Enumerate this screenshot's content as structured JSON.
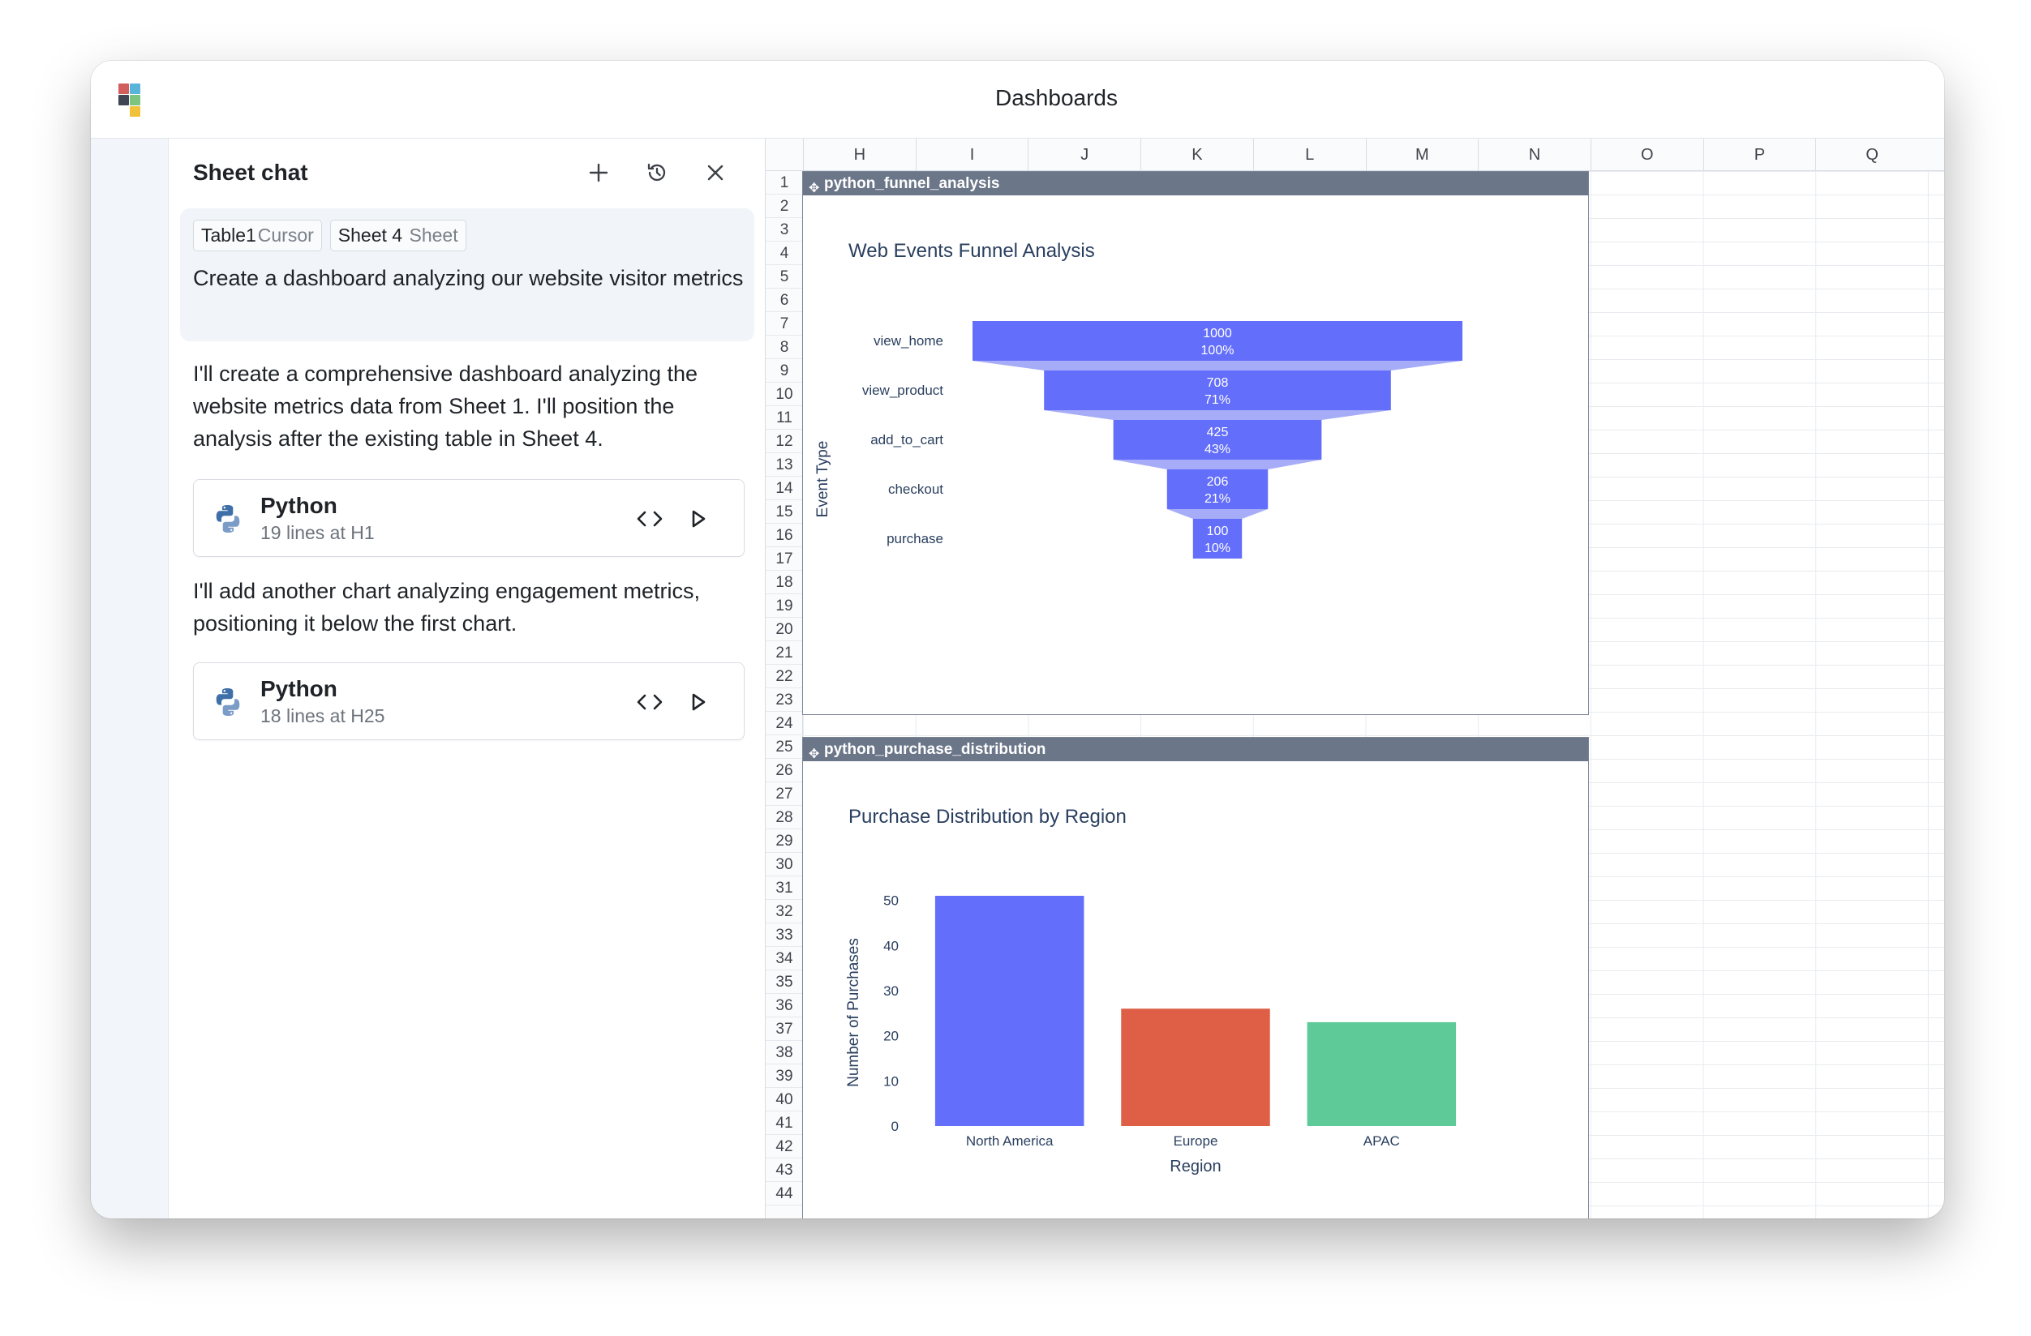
{
  "header": {
    "title": "Dashboards"
  },
  "chat": {
    "title": "Sheet chat",
    "chips": [
      {
        "name": "Table1",
        "type": "Cursor"
      },
      {
        "name": "Sheet 4",
        "type": "Sheet"
      }
    ],
    "user_message": "Create a dashboard analyzing our website visitor metrics",
    "assistant_messages": [
      "I'll create a comprehensive dashboard analyzing the website metrics data from Sheet 1. I'll position the analysis after the existing table in Sheet 4.",
      "I'll add another chart analyzing engagement metrics, positioning it below the first chart."
    ],
    "code_cards": [
      {
        "title": "Python",
        "subtitle": "19 lines at H1"
      },
      {
        "title": "Python",
        "subtitle": "18 lines at H25"
      }
    ]
  },
  "sheet": {
    "columns": [
      "H",
      "I",
      "J",
      "K",
      "L",
      "M",
      "N",
      "O",
      "P",
      "Q"
    ],
    "rows": [
      "1",
      "2",
      "3",
      "4",
      "5",
      "6",
      "7",
      "8",
      "9",
      "10",
      "11",
      "12",
      "13",
      "14",
      "15",
      "16",
      "17",
      "18",
      "19",
      "20",
      "21",
      "22",
      "23",
      "24",
      "25",
      "26",
      "27",
      "28",
      "29",
      "30",
      "31",
      "32",
      "33",
      "34",
      "35",
      "36",
      "37",
      "38",
      "39",
      "40",
      "41",
      "42",
      "43",
      "44"
    ]
  },
  "colors": {
    "funnel": "#636efa",
    "connector": "#a6acf7",
    "north_america": "#636efa",
    "europe": "#de5f45",
    "apac": "#5dca98",
    "object_header": "#6b7689"
  },
  "chart_data": [
    {
      "object_name": "python_funnel_analysis",
      "type": "funnel",
      "title": "Web Events Funnel Analysis",
      "ylabel": "Event Type",
      "categories": [
        "view_home",
        "view_product",
        "add_to_cart",
        "checkout",
        "purchase"
      ],
      "values": [
        1000,
        708,
        425,
        206,
        100
      ],
      "percent_labels": [
        "100%",
        "71%",
        "43%",
        "21%",
        "10%"
      ]
    },
    {
      "object_name": "python_purchase_distribution",
      "type": "bar",
      "title": "Purchase Distribution by Region",
      "xlabel": "Region",
      "ylabel": "Number of Purchases",
      "categories": [
        "North America",
        "Europe",
        "APAC"
      ],
      "values": [
        51,
        26,
        23
      ],
      "yticks": [
        0,
        10,
        20,
        30,
        40,
        50
      ],
      "ylim": [
        0,
        51
      ]
    }
  ]
}
